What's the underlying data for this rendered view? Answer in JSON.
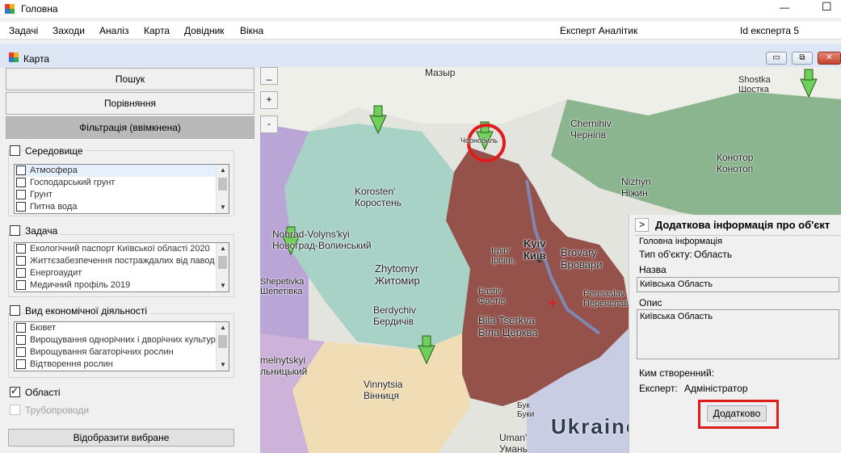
{
  "window": {
    "title": "Головна",
    "minimize_label": "—",
    "maximize_label": "☐"
  },
  "menubar": {
    "items": [
      "Задачі",
      "Заходи",
      "Аналіз",
      "Карта",
      "Довідник",
      "Вікна"
    ],
    "expert_label": "Експерт Аналітик",
    "expert_id_label": "Id експерта 5"
  },
  "map_window": {
    "title": "Карта",
    "buttons": {
      "minimize": "▭",
      "restore": "⧉",
      "close": "✕"
    }
  },
  "sidebar": {
    "search_button": "Пошук",
    "compare_button": "Порівняння",
    "filter_button": "Фільтрація (ввімкнена)",
    "groups": [
      {
        "label": "Середовище",
        "checked": false,
        "items": [
          "Атмосфера",
          "Господарський грунт",
          "Грунт",
          "Питна вода"
        ]
      },
      {
        "label": "Задача",
        "checked": false,
        "items": [
          "Екологічний паспорт Київської області 2020",
          "Життєзабезпечення постраждалих від павод",
          "Енергоаудит",
          "Медичний профіль 2019"
        ]
      },
      {
        "label": "Вид економічної діяльності",
        "checked": false,
        "items": [
          "Бювет",
          "Вирощування однорічних і дворічних культур",
          "Вирощування багаторічних рослин",
          "Відтворення рослин"
        ]
      }
    ],
    "regions": {
      "label": "Області",
      "checked": true
    },
    "pipelines": {
      "label": "Трубопроводи",
      "checked": false,
      "enabled": false
    },
    "show_button": "Відобразити вибране"
  },
  "map": {
    "zoom_out": "_",
    "zoom_in": "+",
    "zoom_minus": "-",
    "labels": {
      "mazyr": "Мазыр",
      "chernihiv": "Chernihiv\nЧернігів",
      "shostka": "Shostka\nШостка",
      "konotop": "Конотор\nКонотоп",
      "nizhyn": "Nizhyn\nНіжин",
      "korosten": "Korosten'\nКоростень",
      "novohrad": "Nohrad-Volyns'kyi\nНовоград-Волинський",
      "zhytomyr": "Zhytomyr\nЖитомир",
      "shepetivka": "Shepetivka\nШепетівка",
      "berdychiv": "Berdychiv\nБердичів",
      "kyiv": "Kyiv\nКиїв",
      "irpin": "Irpin'\nІрпінь",
      "brovary": "Brovary\nБровари",
      "fastiv": "Fastiv\nФастів",
      "bila": "Bila Tserkva\nБіла Церква",
      "pereiaslav": "Pereiaslav\nПереяслав",
      "vinnytsia": "Vinnytsia\nВінниця",
      "khmelnytskyi": "melnytskyi\nльницький",
      "uman": "Uman'\nУмань",
      "bouk": "Бук\nБуки",
      "ukraine": "Ukraine",
      "chornobyl": "Чорнобиль"
    }
  },
  "info_panel": {
    "toggle": ">",
    "title": "Додаткова інформація про об'єкт",
    "section": "Головна інформація",
    "type_label": "Тип об'єкту:",
    "type_value": "Область",
    "name_label": "Назва",
    "name_value": "Київська Область",
    "desc_label": "Опис",
    "desc_value": "Київська Область",
    "created_label": "Ким створенний:",
    "expert_label": "Експерт:",
    "expert_value": "Адміністратор",
    "more_button": "Додатково"
  },
  "colors": {
    "kyiv_region": "#8f4a42",
    "zhytomyr_region": "#a9d2c7",
    "vinnytsia_region": "#f1ddb5",
    "chernihiv_region": "#8bb58f",
    "marker": "#6fd05a",
    "highlight": "#e01b1b"
  }
}
